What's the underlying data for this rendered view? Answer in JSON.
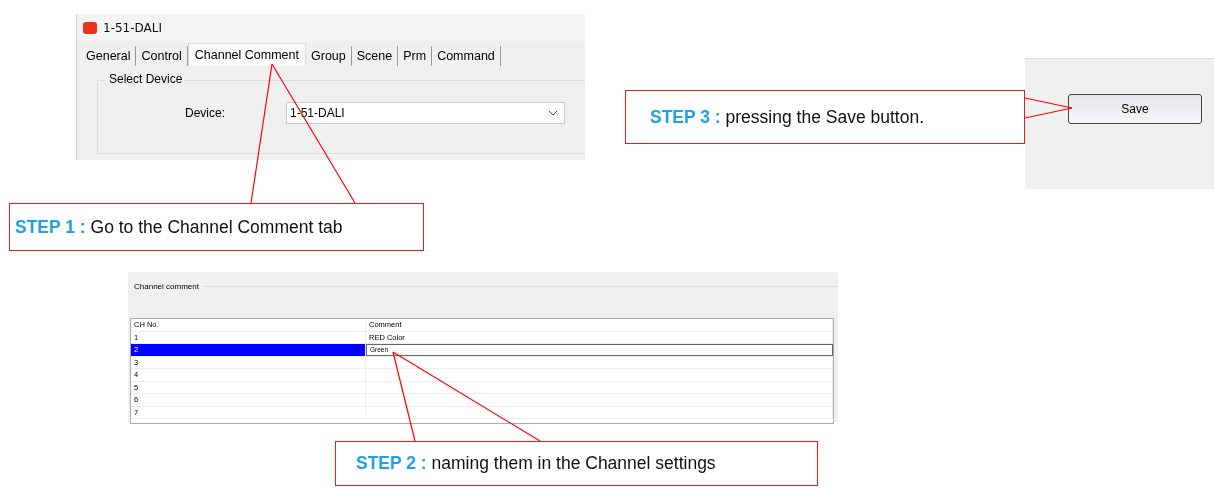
{
  "device_window": {
    "title": "1-51-DALI",
    "tabs": [
      {
        "label": "General",
        "selected": false
      },
      {
        "label": "Control",
        "selected": false
      },
      {
        "label": "Channel Comment",
        "selected": true
      },
      {
        "label": "Group",
        "selected": false
      },
      {
        "label": "Scene",
        "selected": false
      },
      {
        "label": "Prm",
        "selected": false
      },
      {
        "label": "Command",
        "selected": false
      }
    ],
    "group_title": "Select Device",
    "device_label": "Device:",
    "device_value": "1-51-DALI"
  },
  "channel_panel": {
    "group_title": "Channel comment",
    "columns": [
      "CH No.",
      "Comment"
    ],
    "rows": [
      {
        "ch": "1",
        "comment": "RED Color",
        "selected": false,
        "editing": false
      },
      {
        "ch": "2",
        "comment": "Green",
        "selected": true,
        "editing": true
      },
      {
        "ch": "3",
        "comment": "",
        "selected": false,
        "editing": false
      },
      {
        "ch": "4",
        "comment": "",
        "selected": false,
        "editing": false
      },
      {
        "ch": "5",
        "comment": "",
        "selected": false,
        "editing": false
      },
      {
        "ch": "6",
        "comment": "",
        "selected": false,
        "editing": false
      },
      {
        "ch": "7",
        "comment": "",
        "selected": false,
        "editing": false
      }
    ]
  },
  "save_panel": {
    "button": "Save"
  },
  "callouts": [
    {
      "step": "STEP 1 :",
      "text": "Go to the Channel Comment tab"
    },
    {
      "step": "STEP 2 :",
      "text": "naming them in the Channel settings"
    },
    {
      "step": "STEP 3 :",
      "text": "pressing the Save button."
    }
  ]
}
